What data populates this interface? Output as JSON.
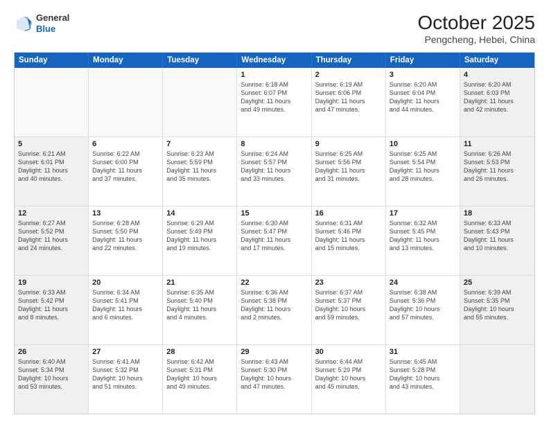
{
  "logo": {
    "general": "General",
    "blue": "Blue"
  },
  "header": {
    "title": "October 2025",
    "subtitle": "Pengcheng, Hebei, China"
  },
  "weekdays": [
    "Sunday",
    "Monday",
    "Tuesday",
    "Wednesday",
    "Thursday",
    "Friday",
    "Saturday"
  ],
  "rows": [
    [
      {
        "day": "",
        "text": "",
        "empty": true
      },
      {
        "day": "",
        "text": "",
        "empty": true
      },
      {
        "day": "",
        "text": "",
        "empty": true
      },
      {
        "day": "1",
        "text": "Sunrise: 6:18 AM\nSunset: 6:07 PM\nDaylight: 11 hours\nand 49 minutes."
      },
      {
        "day": "2",
        "text": "Sunrise: 6:19 AM\nSunset: 6:06 PM\nDaylight: 11 hours\nand 47 minutes."
      },
      {
        "day": "3",
        "text": "Sunrise: 6:20 AM\nSunset: 6:04 PM\nDaylight: 11 hours\nand 44 minutes."
      },
      {
        "day": "4",
        "text": "Sunrise: 6:20 AM\nSunset: 6:03 PM\nDaylight: 11 hours\nand 42 minutes.",
        "shaded": true
      }
    ],
    [
      {
        "day": "5",
        "text": "Sunrise: 6:21 AM\nSunset: 6:01 PM\nDaylight: 11 hours\nand 40 minutes.",
        "shaded": true
      },
      {
        "day": "6",
        "text": "Sunrise: 6:22 AM\nSunset: 6:00 PM\nDaylight: 11 hours\nand 37 minutes."
      },
      {
        "day": "7",
        "text": "Sunrise: 6:23 AM\nSunset: 5:59 PM\nDaylight: 11 hours\nand 35 minutes."
      },
      {
        "day": "8",
        "text": "Sunrise: 6:24 AM\nSunset: 5:57 PM\nDaylight: 11 hours\nand 33 minutes."
      },
      {
        "day": "9",
        "text": "Sunrise: 6:25 AM\nSunset: 5:56 PM\nDaylight: 11 hours\nand 31 minutes."
      },
      {
        "day": "10",
        "text": "Sunrise: 6:25 AM\nSunset: 5:54 PM\nDaylight: 11 hours\nand 28 minutes."
      },
      {
        "day": "11",
        "text": "Sunrise: 6:26 AM\nSunset: 5:53 PM\nDaylight: 11 hours\nand 26 minutes.",
        "shaded": true
      }
    ],
    [
      {
        "day": "12",
        "text": "Sunrise: 6:27 AM\nSunset: 5:52 PM\nDaylight: 11 hours\nand 24 minutes.",
        "shaded": true
      },
      {
        "day": "13",
        "text": "Sunrise: 6:28 AM\nSunset: 5:50 PM\nDaylight: 11 hours\nand 22 minutes."
      },
      {
        "day": "14",
        "text": "Sunrise: 6:29 AM\nSunset: 5:49 PM\nDaylight: 11 hours\nand 19 minutes."
      },
      {
        "day": "15",
        "text": "Sunrise: 6:30 AM\nSunset: 5:47 PM\nDaylight: 11 hours\nand 17 minutes."
      },
      {
        "day": "16",
        "text": "Sunrise: 6:31 AM\nSunset: 5:46 PM\nDaylight: 11 hours\nand 15 minutes."
      },
      {
        "day": "17",
        "text": "Sunrise: 6:32 AM\nSunset: 5:45 PM\nDaylight: 11 hours\nand 13 minutes."
      },
      {
        "day": "18",
        "text": "Sunrise: 6:33 AM\nSunset: 5:43 PM\nDaylight: 11 hours\nand 10 minutes.",
        "shaded": true
      }
    ],
    [
      {
        "day": "19",
        "text": "Sunrise: 6:33 AM\nSunset: 5:42 PM\nDaylight: 11 hours\nand 8 minutes.",
        "shaded": true
      },
      {
        "day": "20",
        "text": "Sunrise: 6:34 AM\nSunset: 5:41 PM\nDaylight: 11 hours\nand 6 minutes."
      },
      {
        "day": "21",
        "text": "Sunrise: 6:35 AM\nSunset: 5:40 PM\nDaylight: 11 hours\nand 4 minutes."
      },
      {
        "day": "22",
        "text": "Sunrise: 6:36 AM\nSunset: 5:38 PM\nDaylight: 11 hours\nand 2 minutes."
      },
      {
        "day": "23",
        "text": "Sunrise: 6:37 AM\nSunset: 5:37 PM\nDaylight: 10 hours\nand 59 minutes."
      },
      {
        "day": "24",
        "text": "Sunrise: 6:38 AM\nSunset: 5:36 PM\nDaylight: 10 hours\nand 57 minutes."
      },
      {
        "day": "25",
        "text": "Sunrise: 6:39 AM\nSunset: 5:35 PM\nDaylight: 10 hours\nand 55 minutes.",
        "shaded": true
      }
    ],
    [
      {
        "day": "26",
        "text": "Sunrise: 6:40 AM\nSunset: 5:34 PM\nDaylight: 10 hours\nand 53 minutes.",
        "shaded": true
      },
      {
        "day": "27",
        "text": "Sunrise: 6:41 AM\nSunset: 5:32 PM\nDaylight: 10 hours\nand 51 minutes."
      },
      {
        "day": "28",
        "text": "Sunrise: 6:42 AM\nSunset: 5:31 PM\nDaylight: 10 hours\nand 49 minutes."
      },
      {
        "day": "29",
        "text": "Sunrise: 6:43 AM\nSunset: 5:30 PM\nDaylight: 10 hours\nand 47 minutes."
      },
      {
        "day": "30",
        "text": "Sunrise: 6:44 AM\nSunset: 5:29 PM\nDaylight: 10 hours\nand 45 minutes."
      },
      {
        "day": "31",
        "text": "Sunrise: 6:45 AM\nSunset: 5:28 PM\nDaylight: 10 hours\nand 43 minutes."
      },
      {
        "day": "",
        "text": "",
        "empty": true,
        "shaded": true
      }
    ]
  ]
}
